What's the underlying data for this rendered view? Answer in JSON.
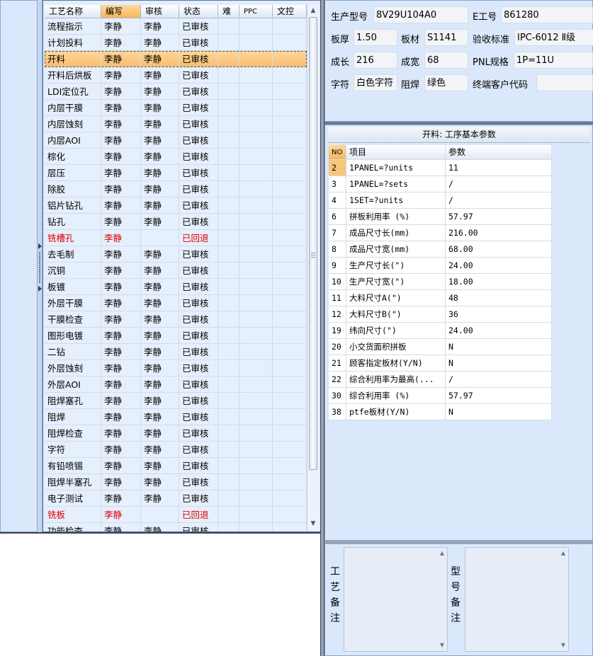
{
  "grid": {
    "columns": [
      "工艺名称",
      "编写",
      "审核",
      "状态",
      "难",
      "PPC",
      "文控"
    ],
    "rows": [
      {
        "name": "流程指示",
        "writer": "李静",
        "reviewer": "李静",
        "status": "已审核"
      },
      {
        "name": "计划投料",
        "writer": "李静",
        "reviewer": "李静",
        "status": "已审核"
      },
      {
        "name": "开料",
        "writer": "李静",
        "reviewer": "李静",
        "status": "已审核",
        "selected": true
      },
      {
        "name": "开料后烘板",
        "writer": "李静",
        "reviewer": "李静",
        "status": "已审核"
      },
      {
        "name": "LDI定位孔",
        "writer": "李静",
        "reviewer": "李静",
        "status": "已审核"
      },
      {
        "name": "内层干膜",
        "writer": "李静",
        "reviewer": "李静",
        "status": "已审核"
      },
      {
        "name": "内层蚀刻",
        "writer": "李静",
        "reviewer": "李静",
        "status": "已审核"
      },
      {
        "name": "内层AOI",
        "writer": "李静",
        "reviewer": "李静",
        "status": "已审核"
      },
      {
        "name": "棕化",
        "writer": "李静",
        "reviewer": "李静",
        "status": "已审核"
      },
      {
        "name": "层压",
        "writer": "李静",
        "reviewer": "李静",
        "status": "已审核"
      },
      {
        "name": "除胶",
        "writer": "李静",
        "reviewer": "李静",
        "status": "已审核"
      },
      {
        "name": "铝片钻孔",
        "writer": "李静",
        "reviewer": "李静",
        "status": "已审核"
      },
      {
        "name": "钻孔",
        "writer": "李静",
        "reviewer": "李静",
        "status": "已审核"
      },
      {
        "name": "铣槽孔",
        "writer": "李静",
        "reviewer": "",
        "status": "已回退",
        "rejected": true
      },
      {
        "name": "去毛制",
        "writer": "李静",
        "reviewer": "李静",
        "status": "已审核"
      },
      {
        "name": "沉铜",
        "writer": "李静",
        "reviewer": "李静",
        "status": "已审核"
      },
      {
        "name": "板镀",
        "writer": "李静",
        "reviewer": "李静",
        "status": "已审核"
      },
      {
        "name": "外层干膜",
        "writer": "李静",
        "reviewer": "李静",
        "status": "已审核"
      },
      {
        "name": "干膜检查",
        "writer": "李静",
        "reviewer": "李静",
        "status": "已审核"
      },
      {
        "name": "图形电镀",
        "writer": "李静",
        "reviewer": "李静",
        "status": "已审核"
      },
      {
        "name": "二钻",
        "writer": "李静",
        "reviewer": "李静",
        "status": "已审核"
      },
      {
        "name": "外层蚀刻",
        "writer": "李静",
        "reviewer": "李静",
        "status": "已审核"
      },
      {
        "name": "外层AOI",
        "writer": "李静",
        "reviewer": "李静",
        "status": "已审核"
      },
      {
        "name": "阻焊塞孔",
        "writer": "李静",
        "reviewer": "李静",
        "status": "已审核"
      },
      {
        "name": "阻焊",
        "writer": "李静",
        "reviewer": "李静",
        "status": "已审核"
      },
      {
        "name": "阻焊检查",
        "writer": "李静",
        "reviewer": "李静",
        "status": "已审核"
      },
      {
        "name": "字符",
        "writer": "李静",
        "reviewer": "李静",
        "status": "已审核"
      },
      {
        "name": "有铅喷锡",
        "writer": "李静",
        "reviewer": "李静",
        "status": "已审核"
      },
      {
        "name": "阻焊半塞孔",
        "writer": "李静",
        "reviewer": "李静",
        "status": "已审核"
      },
      {
        "name": "电子测试",
        "writer": "李静",
        "reviewer": "李静",
        "status": "已审核"
      },
      {
        "name": "铣板",
        "writer": "李静",
        "reviewer": "",
        "status": "已回退",
        "rejected": true
      },
      {
        "name": "功能检查",
        "writer": "李静",
        "reviewer": "李静",
        "status": "已审核"
      }
    ]
  },
  "info": {
    "model_label": "生产型号",
    "model_value": "8V29U104A0",
    "eno_label": "E工号",
    "eno_value": "861280",
    "thickness_label": "板厚",
    "thickness_value": "1.50",
    "material_label": "板材",
    "material_value": "S1141",
    "standard_label": "验收标准",
    "standard_value": "IPC-6012 Ⅱ级",
    "length_label": "成长",
    "length_value": "216",
    "width_label": "成宽",
    "width_value": "68",
    "pnl_label": "PNL规格",
    "pnl_value": "1P=11U",
    "char_label": "字符",
    "char_value": "白色字符",
    "mask_label": "阻焊",
    "mask_value": "绿色",
    "customer_label": "终端客户代码",
    "customer_value": ""
  },
  "params": {
    "title": "开料: 工序基本参数",
    "columns": [
      "NO",
      "项目",
      "参数"
    ],
    "rows": [
      {
        "no": "2",
        "item": "1PANEL=?units",
        "value": "11"
      },
      {
        "no": "3",
        "item": "1PANEL=?sets",
        "value": "/"
      },
      {
        "no": "4",
        "item": "1SET=?units",
        "value": "/"
      },
      {
        "no": "6",
        "item": "拼板利用率 (%)",
        "value": "57.97"
      },
      {
        "no": "7",
        "item": "成品尺寸长(mm)",
        "value": "216.00"
      },
      {
        "no": "8",
        "item": "成品尺寸宽(mm)",
        "value": "68.00"
      },
      {
        "no": "9",
        "item": "生产尺寸长(\")",
        "value": "24.00"
      },
      {
        "no": "10",
        "item": "生产尺寸宽(\")",
        "value": "18.00"
      },
      {
        "no": "11",
        "item": "大料尺寸A(\")",
        "value": "48"
      },
      {
        "no": "12",
        "item": "大料尺寸B(\")",
        "value": "36"
      },
      {
        "no": "19",
        "item": "纬向尺寸(\")",
        "value": "24.00"
      },
      {
        "no": "20",
        "item": "小交货面积拼板",
        "value": "N"
      },
      {
        "no": "21",
        "item": "顾客指定板材(Y/N)",
        "value": "N"
      },
      {
        "no": "22",
        "item": "综合利用率为最高(...",
        "value": "/"
      },
      {
        "no": "30",
        "item": "综合利用率 (%)",
        "value": "57.97"
      },
      {
        "no": "38",
        "item": "ptfe板材(Y/N)",
        "value": "N"
      }
    ]
  },
  "notes": {
    "process_label": [
      "工",
      "艺",
      "备",
      "注"
    ],
    "model_label": [
      "型",
      "号",
      "备",
      "注"
    ]
  }
}
